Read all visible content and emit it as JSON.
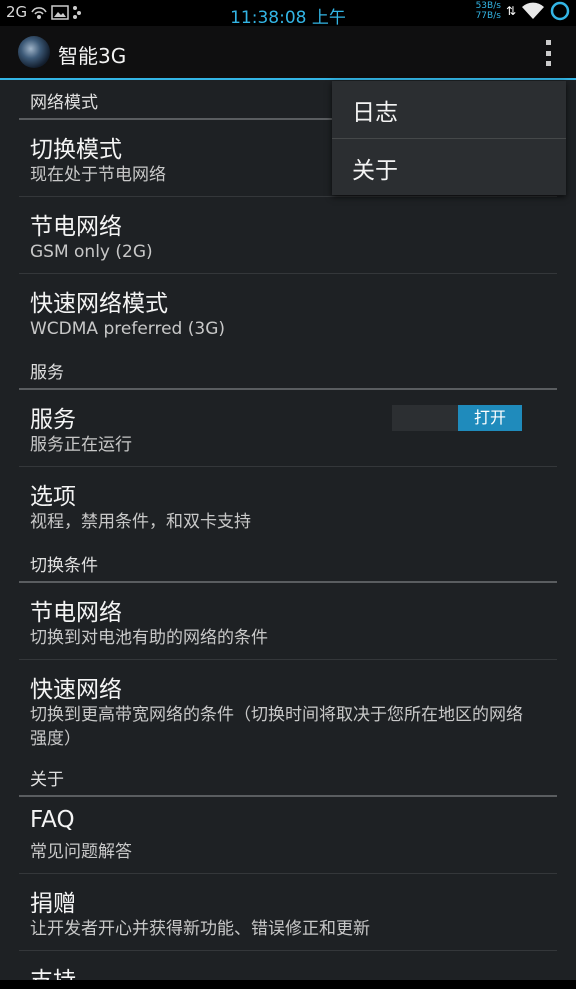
{
  "status_bar": {
    "network": "2G",
    "time": "11:38:08 上午",
    "speed_up": "53B/s",
    "speed_down": "77B/s",
    "accent_color": "#33b5e5"
  },
  "action_bar": {
    "app_icon": "planet-app-icon",
    "title": "智能3G",
    "overflow_icon": "overflow-menu-icon"
  },
  "menu": {
    "items": [
      {
        "label": "日志"
      },
      {
        "label": "关于"
      }
    ]
  },
  "sections": [
    {
      "header": "网络模式",
      "items": [
        {
          "title": "切换模式",
          "summary": "现在处于节电网络"
        },
        {
          "title": "节电网络",
          "summary": "GSM only (2G)"
        },
        {
          "title": "快速网络模式",
          "summary": "WCDMA preferred (3G)"
        }
      ]
    },
    {
      "header": "服务",
      "items": [
        {
          "title": "服务",
          "summary": "服务正在运行",
          "toggle": "打开",
          "toggle_on": true
        },
        {
          "title": "选项",
          "summary": "视程，禁用条件，和双卡支持"
        }
      ]
    },
    {
      "header": "切换条件",
      "items": [
        {
          "title": "节电网络",
          "summary": "切换到对电池有助的网络的条件"
        },
        {
          "title": "快速网络",
          "summary": "切换到更高带宽网络的条件（切换时间将取决于您所在地区的网络强度）"
        }
      ]
    },
    {
      "header": "关于",
      "items": [
        {
          "title": "FAQ",
          "summary": "常见问题解答"
        },
        {
          "title": "捐赠",
          "summary": "让开发者开心并获得新功能、错误修正和更新"
        },
        {
          "title": "支持",
          "summary": ""
        }
      ]
    }
  ]
}
